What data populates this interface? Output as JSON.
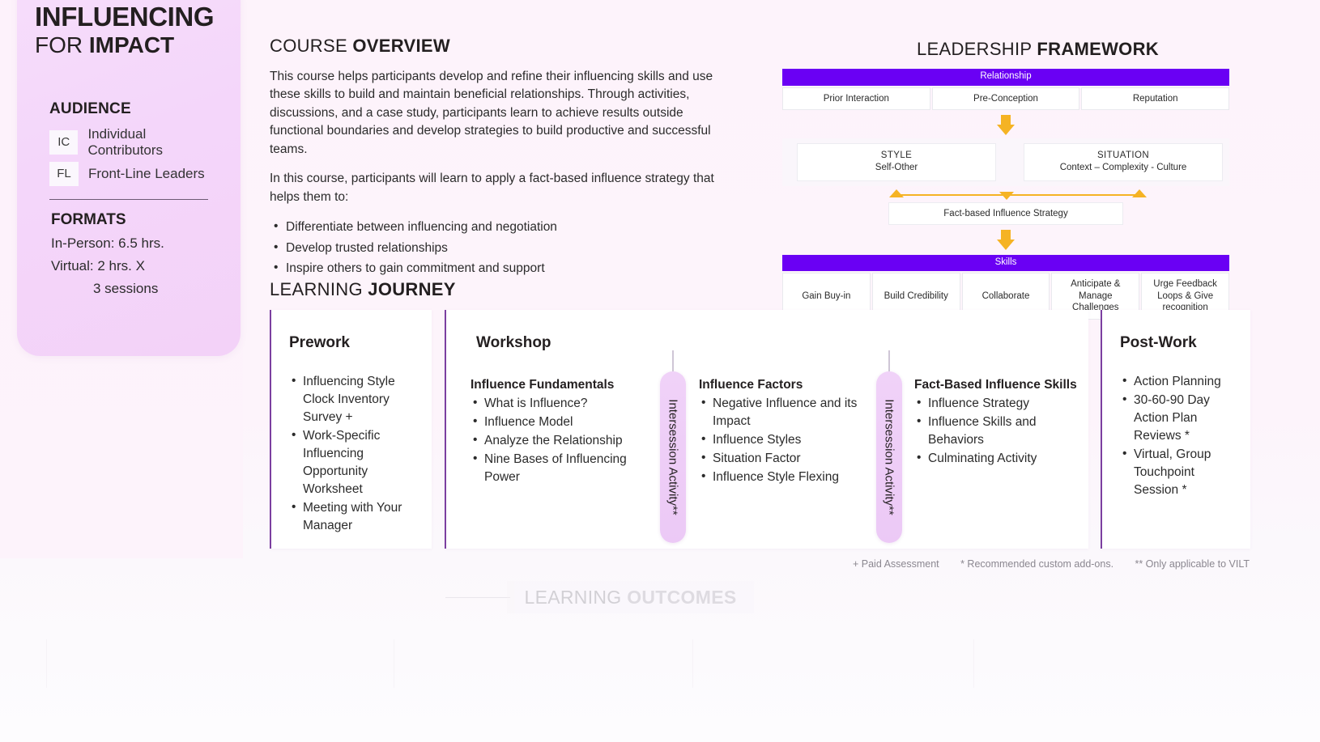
{
  "hero": {
    "title_line1": "INFLUENCING",
    "title_line2_thin": "FOR ",
    "title_line2_bold": "IMPACT",
    "audience_heading": "AUDIENCE",
    "audience": [
      {
        "code": "IC",
        "label": "Individual Contributors"
      },
      {
        "code": "FL",
        "label": "Front-Line Leaders"
      }
    ],
    "formats_heading": "FORMATS",
    "format_in_person": "In-Person: 6.5 hrs.",
    "format_virtual": "Virtual:  2 hrs. X",
    "format_virtual_cont": "3 sessions"
  },
  "overview": {
    "heading_thin": "COURSE ",
    "heading_bold": "OVERVIEW",
    "paragraph1": "This course helps participants develop and refine their influencing skills and use these skills to build and maintain beneficial relationships. Through activities, discussions, and a case study, participants learn to achieve results outside functional boundaries and develop strategies to build productive and successful teams.",
    "paragraph2": "In this course, participants will learn to apply a fact-based influence strategy that helps them to:",
    "bullets": [
      "Differentiate between influencing and negotiation",
      "Develop trusted relationships",
      "Inspire others to gain commitment and support"
    ]
  },
  "framework": {
    "heading_thin": "LEADERSHIP ",
    "heading_bold": "FRAMEWORK",
    "band_relationship": "Relationship",
    "relationship_cells": [
      "Prior Interaction",
      "Pre-Conception",
      "Reputation"
    ],
    "style_title": "STYLE",
    "style_sub": "Self-Other",
    "situation_title": "SITUATION",
    "situation_sub": "Context – Complexity - Culture",
    "strategy": "Fact-based Influence Strategy",
    "band_skills": "Skills",
    "skills_cells": [
      "Gain Buy-in",
      "Build Credibility",
      "Collaborate",
      "Anticipate & Manage Challenges",
      "Urge Feedback Loops & Give recognition"
    ],
    "accent_purple": "#6a00f4",
    "accent_amber": "#f5b324"
  },
  "journey": {
    "heading_thin": "LEARNING ",
    "heading_bold": "JOURNEY",
    "prework": {
      "title": "Prework",
      "items": [
        "Influencing Style Clock Inventory Survey +",
        "Work-Specific Influencing Opportunity Worksheet",
        "Meeting with Your Manager"
      ]
    },
    "workshop": {
      "title": "Workshop",
      "group1_title": "Influence Fundamentals",
      "group1_items": [
        "What is Influence?",
        "Influence Model",
        "Analyze the Relationship",
        "Nine Bases of Influencing Power"
      ],
      "group2_title": "Influence Factors",
      "group2_items": [
        "Negative Influence and its Impact",
        "Influence Styles",
        "Situation Factor",
        "Influence Style Flexing"
      ],
      "group3_title": "Fact-Based Influence Skills",
      "group3_items": [
        "Influence Strategy",
        "Influence Skills and Behaviors",
        "Culminating Activity"
      ],
      "intersession_label_1": "Intersession Activity**",
      "intersession_label_2": "Intersession Activity**"
    },
    "postwork": {
      "title": "Post-Work",
      "items": [
        "Action Planning",
        "30-60-90 Day Action Plan Reviews *",
        "Virtual, Group Touchpoint Session *"
      ]
    }
  },
  "footnotes": [
    "+ Paid Assessment",
    "* Recommended custom add-ons.",
    "** Only applicable to VILT"
  ],
  "outcomes": {
    "heading_thin": "LEARNING ",
    "heading_bold": "OUTCOMES"
  }
}
